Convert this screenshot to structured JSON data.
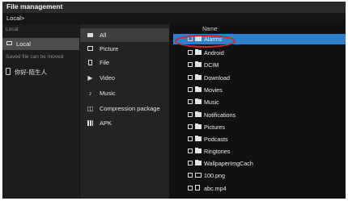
{
  "title": "File management",
  "breadcrumb": "Local>",
  "left_panel": {
    "section_local": "Local",
    "local_item": "Local",
    "section_saved": "Saved file can be moved",
    "saved_item": "你好-陌生人"
  },
  "categories": [
    {
      "label": "All",
      "icon": "grid-icon",
      "selected": true
    },
    {
      "label": "Picture",
      "icon": "picture-icon",
      "selected": false
    },
    {
      "label": "File",
      "icon": "file-icon",
      "selected": false
    },
    {
      "label": "Video",
      "icon": "video-icon",
      "selected": false
    },
    {
      "label": "Music",
      "icon": "music-icon",
      "selected": false
    },
    {
      "label": "Compression package",
      "icon": "compression-icon",
      "selected": false
    },
    {
      "label": "APK",
      "icon": "apk-icon",
      "selected": false
    }
  ],
  "file_list": {
    "column_header": "Name",
    "items": [
      {
        "name": "Alarms",
        "type": "folder",
        "selected": true
      },
      {
        "name": "Android",
        "type": "folder"
      },
      {
        "name": "DCIM",
        "type": "folder"
      },
      {
        "name": "Download",
        "type": "folder"
      },
      {
        "name": "Movies",
        "type": "folder"
      },
      {
        "name": "Music",
        "type": "folder"
      },
      {
        "name": "Notifications",
        "type": "folder"
      },
      {
        "name": "Pictures",
        "type": "folder"
      },
      {
        "name": "Podcasts",
        "type": "folder"
      },
      {
        "name": "Ringtones",
        "type": "folder"
      },
      {
        "name": "WallpaperImgCach",
        "type": "folder"
      },
      {
        "name": "100.png",
        "type": "image"
      },
      {
        "name": "abc.mp4",
        "type": "video"
      }
    ]
  },
  "colors": {
    "selection": "#2f7fcc",
    "annotation": "#d2232a"
  }
}
